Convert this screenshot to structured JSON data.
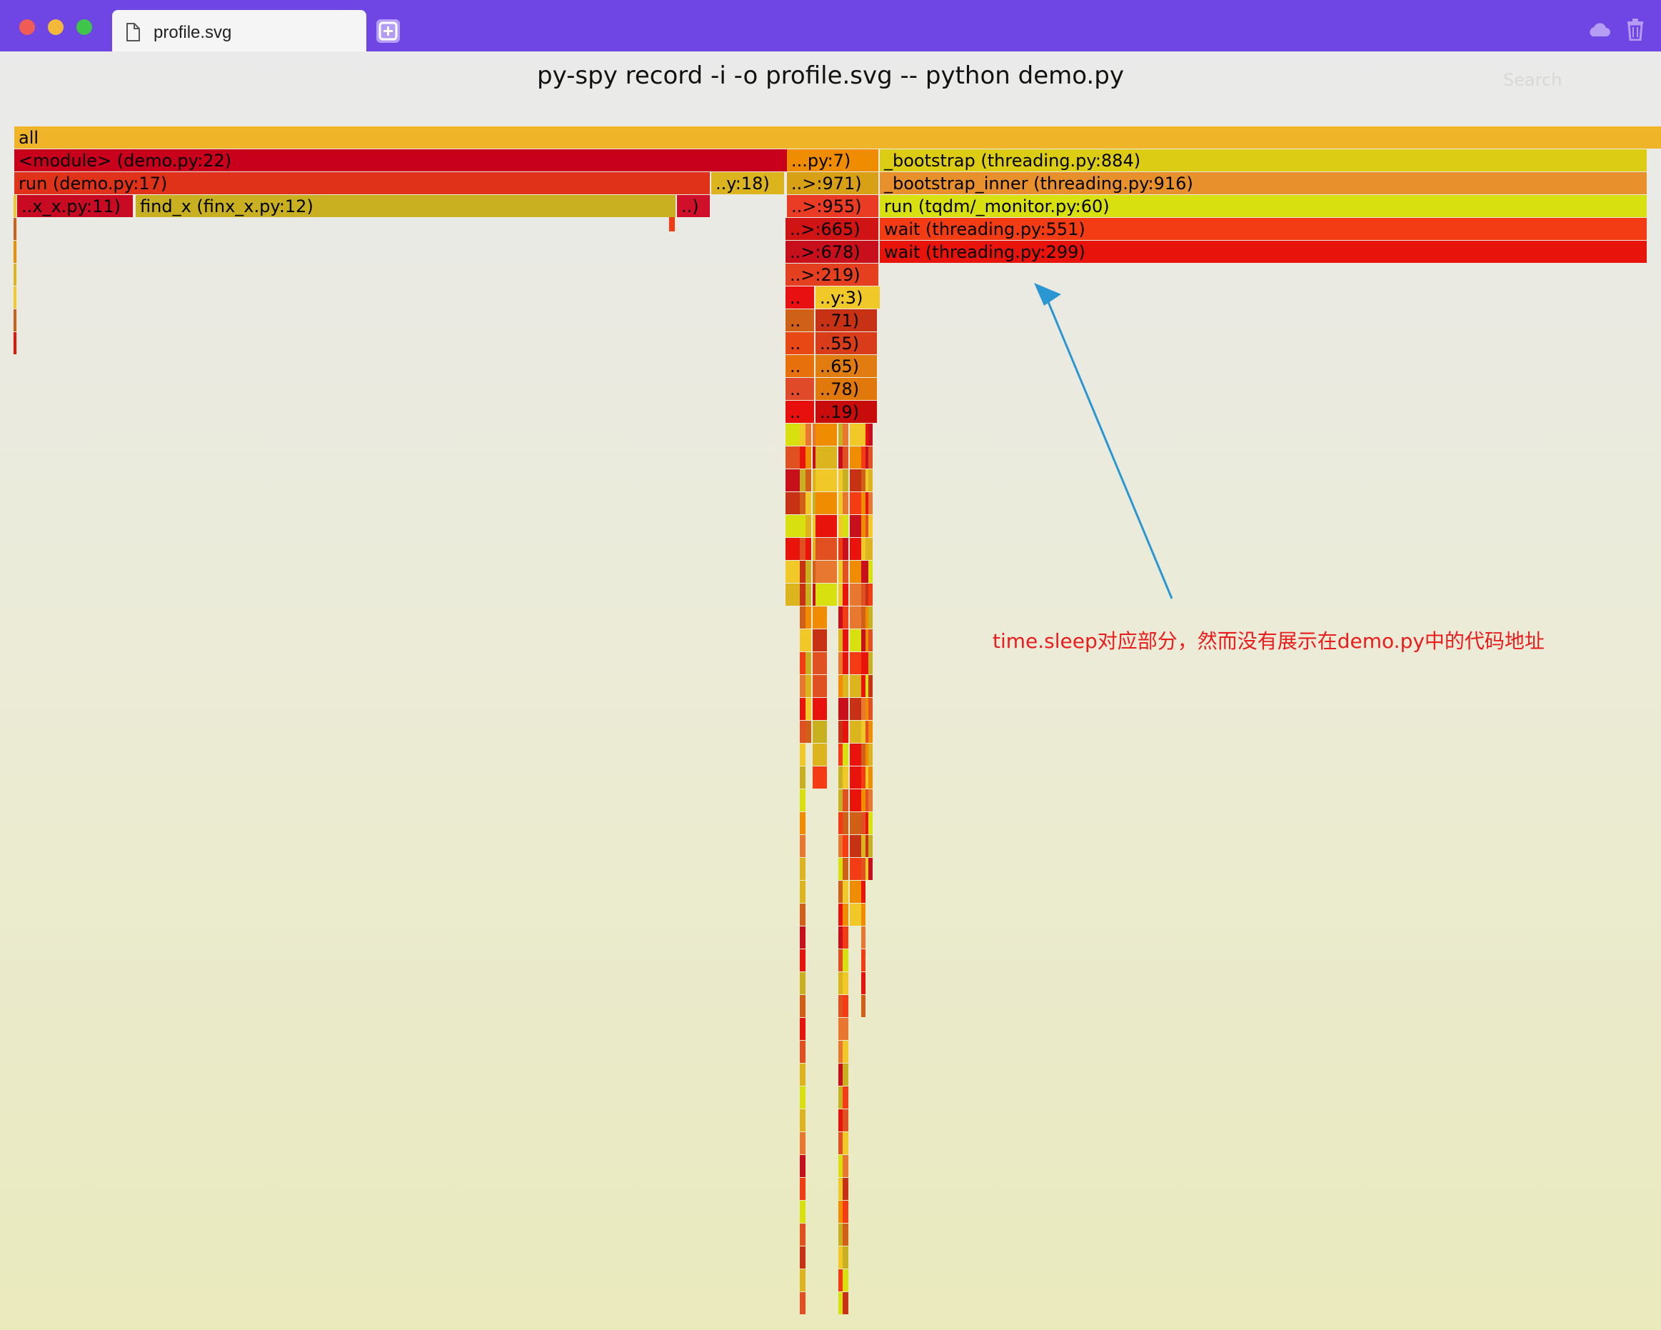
{
  "window": {
    "tab_title": "profile.svg",
    "icons": [
      "close-dot",
      "minimize-dot",
      "maximize-dot",
      "file-icon",
      "plus-icon",
      "cloud-icon",
      "trash-icon"
    ]
  },
  "page": {
    "title": "py-spy record -i -o profile.svg -- python demo.py",
    "search_label": "Search"
  },
  "flamegraph": {
    "frames": [
      {
        "label": "all",
        "color": "#f0b428"
      },
      {
        "label": "<module> (demo.py:22)",
        "color": "#c8001c"
      },
      {
        "label": "...py:7)",
        "color": "#f08c00"
      },
      {
        "label": "_bootstrap (threading.py:884)",
        "color": "#dccc14"
      },
      {
        "label": "run (demo.py:17)",
        "color": "#e03218"
      },
      {
        "label": "..y:18)",
        "color": "#dcb41e"
      },
      {
        "label": "..>:971)",
        "color": "#d8a014"
      },
      {
        "label": "_bootstrap_inner (threading.py:916)",
        "color": "#e8902c"
      },
      {
        "label": "..x_x.py:11)",
        "color": "#c80a22"
      },
      {
        "label": "find_x (finx_x.py:12)",
        "color": "#c8b020"
      },
      {
        "label": "..)",
        "color": "#d0102a"
      },
      {
        "label": "..>:955)",
        "color": "#ea3c24"
      },
      {
        "label": "run (tqdm/_monitor.py:60)",
        "color": "#d8e010"
      },
      {
        "label": "..>:665)",
        "color": "#d01414"
      },
      {
        "label": "wait (threading.py:551)",
        "color": "#f43c14"
      },
      {
        "label": "..>:678)",
        "color": "#c8101c"
      },
      {
        "label": "wait (threading.py:299)",
        "color": "#e8140c"
      },
      {
        "label": "..>:219)",
        "color": "#e44020"
      },
      {
        "label": "..",
        "color": "#e81010"
      },
      {
        "label": "..y:3)",
        "color": "#f0c828"
      },
      {
        "label": "..",
        "color": "#d06018"
      },
      {
        "label": "..71)",
        "color": "#c83214"
      },
      {
        "label": "..",
        "color": "#e84814"
      },
      {
        "label": "..55)",
        "color": "#d83c18"
      },
      {
        "label": "..",
        "color": "#e8700c"
      },
      {
        "label": "..65)",
        "color": "#e07c10"
      },
      {
        "label": "..",
        "color": "#e04a28"
      },
      {
        "label": "..78)",
        "color": "#e0780c"
      },
      {
        "label": "..",
        "color": "#e8100c"
      },
      {
        "label": "..19)",
        "color": "#c80c0c"
      }
    ],
    "palette": [
      "#e8140c",
      "#f08c00",
      "#dcb41e",
      "#c8101c",
      "#e05020",
      "#f0c828",
      "#d06018",
      "#d8e010",
      "#e87830",
      "#c83214",
      "#f43c14",
      "#c8b020"
    ]
  },
  "annotation": {
    "text": "time.sleep对应部分，然而没有展示在demo.py中的代码地址",
    "text_color": "#ea1c1c",
    "arrow_color": "#2a96d2"
  }
}
